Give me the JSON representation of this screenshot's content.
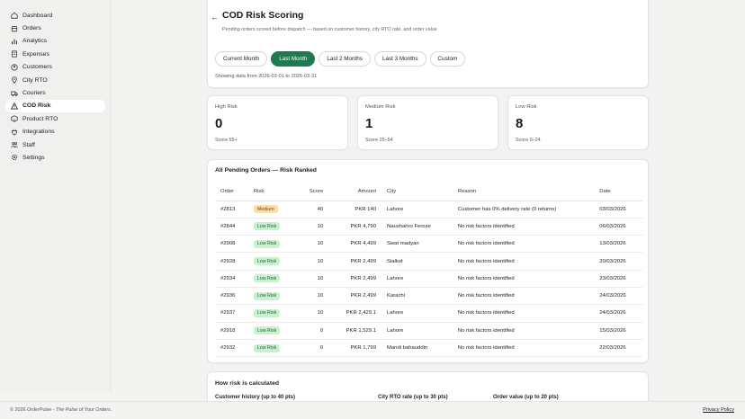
{
  "sidebar": {
    "items": [
      {
        "label": "Dashboard",
        "icon": "home-icon"
      },
      {
        "label": "Orders",
        "icon": "box-icon"
      },
      {
        "label": "Analytics",
        "icon": "bar-chart-icon"
      },
      {
        "label": "Expenses",
        "icon": "receipt-icon"
      },
      {
        "label": "Customers",
        "icon": "user-icon"
      },
      {
        "label": "City RTO",
        "icon": "map-pin-icon"
      },
      {
        "label": "Couriers",
        "icon": "truck-icon"
      },
      {
        "label": "COD Risk",
        "icon": "warning-icon",
        "active": true
      },
      {
        "label": "Product RTO",
        "icon": "package-icon"
      },
      {
        "label": "Integrations",
        "icon": "plug-icon"
      },
      {
        "label": "Staff",
        "icon": "users-icon"
      },
      {
        "label": "Settings",
        "icon": "gear-icon"
      }
    ]
  },
  "header": {
    "title": "COD Risk Scoring",
    "subtitle": "Pending orders scored before dispatch — based on customer history, city RTO rate, and order value",
    "ranges": [
      {
        "label": "Current Month",
        "active": false
      },
      {
        "label": "Last Month",
        "active": true
      },
      {
        "label": "Last 2 Months",
        "active": false
      },
      {
        "label": "Last 3 Months",
        "active": false
      },
      {
        "label": "Custom",
        "active": false
      }
    ],
    "range_info": "Showing data from 2026-03-01 to 2026-03-31"
  },
  "summary": {
    "high": {
      "label": "High Risk",
      "count": "0",
      "range": "Score 55+"
    },
    "medium": {
      "label": "Medium Risk",
      "count": "1",
      "range": "Score 25–54"
    },
    "low": {
      "label": "Low Risk",
      "count": "8",
      "range": "Score 0–24"
    }
  },
  "orders": {
    "title": "All Pending Orders — Risk Ranked",
    "columns": [
      "Order",
      "Risk",
      "Score",
      "Amount",
      "City",
      "Reason",
      "Date"
    ],
    "rows": [
      {
        "order": "#2813",
        "risk": "Medium",
        "level": "medium",
        "score": "40",
        "amount": "PKR 140",
        "city": "Lahore",
        "reason": "Customer has 0% delivery rate (0 returns)",
        "date": "03/03/2026"
      },
      {
        "order": "#2844",
        "risk": "Low Risk",
        "level": "low",
        "score": "10",
        "amount": "PKR 4,790",
        "city": "Naushahro Feroze",
        "reason": "No risk factors identified",
        "date": "06/03/2026"
      },
      {
        "order": "#2908",
        "risk": "Low Risk",
        "level": "low",
        "score": "10",
        "amount": "PKR 4,499",
        "city": "Swat madyan",
        "reason": "No risk factors identified",
        "date": "13/03/2026"
      },
      {
        "order": "#2928",
        "risk": "Low Risk",
        "level": "low",
        "score": "10",
        "amount": "PKR 2,499",
        "city": "Sialkot",
        "reason": "No risk factors identified",
        "date": "20/03/2026"
      },
      {
        "order": "#2934",
        "risk": "Low Risk",
        "level": "low",
        "score": "10",
        "amount": "PKR 2,499",
        "city": "Lahore",
        "reason": "No risk factors identified",
        "date": "23/03/2026"
      },
      {
        "order": "#2936",
        "risk": "Low Risk",
        "level": "low",
        "score": "10",
        "amount": "PKR 2,499",
        "city": "Karachi",
        "reason": "No risk factors identified",
        "date": "24/03/2026"
      },
      {
        "order": "#2937",
        "risk": "Low Risk",
        "level": "low",
        "score": "10",
        "amount": "PKR 2,429.1",
        "city": "Lahore",
        "reason": "No risk factors identified",
        "date": "24/03/2026"
      },
      {
        "order": "#2918",
        "risk": "Low Risk",
        "level": "low",
        "score": "0",
        "amount": "PKR 1,529.1",
        "city": "Lahore",
        "reason": "No risk factors identified",
        "date": "15/03/2026"
      },
      {
        "order": "#2932",
        "risk": "Low Risk",
        "level": "low",
        "score": "0",
        "amount": "PKR 1,799",
        "city": "Mandi bahauddin",
        "reason": "No risk factors identified",
        "date": "22/03/2026"
      }
    ]
  },
  "calculation": {
    "title": "How risk is calculated",
    "customer_history": "Customer history (up to 40 pts)",
    "city_rto": "City RTO rate (up to 30 pts)",
    "order_value": "Order value (up to 20 pts)"
  },
  "footer": {
    "copyright": "© 2026 OrderPulse - ",
    "tagline": "The Pulse of Your Orders.",
    "privacy": "Privacy Policy"
  },
  "colors": {
    "accent": "#1f7a4f",
    "medium_badge": "#fbdcaa",
    "low_badge": "#c9f0cf"
  }
}
